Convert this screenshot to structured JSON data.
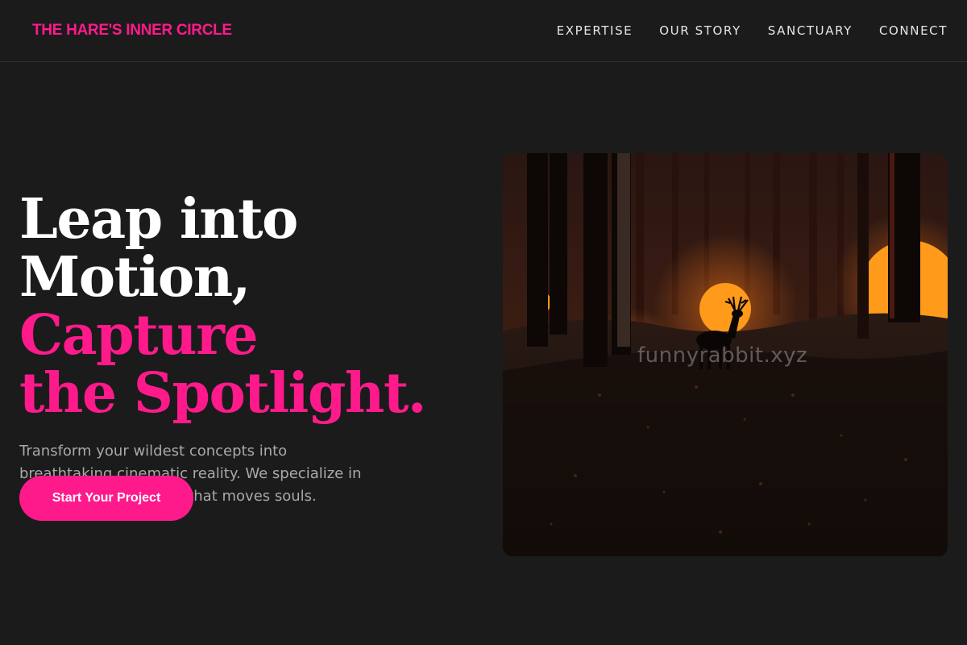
{
  "header": {
    "brand": "THE HARE'S INNER CIRCLE",
    "nav": [
      "EXPERTISE",
      "OUR STORY",
      "SANCTUARY",
      "CONNECT"
    ]
  },
  "hero": {
    "title_line1": "Leap into",
    "title_line2_white": "Motion, ",
    "title_line2_accent": "Capture",
    "title_line3_accent": "the Spotlight.",
    "subtitle": "Transform your wildest concepts into breathtaking cinematic reality. We specialize in high-fidelity animation that moves souls.",
    "cta_label": "Start Your Project"
  },
  "image": {
    "watermark": "funnyrabbit.xyz",
    "scene": "dark forest with glowing orange orbs and deer silhouette"
  },
  "colors": {
    "background": "#1b1b1b",
    "accent": "#ff1a8c",
    "muted_text": "#a9a9a9",
    "orb": "#ff9a1a"
  }
}
